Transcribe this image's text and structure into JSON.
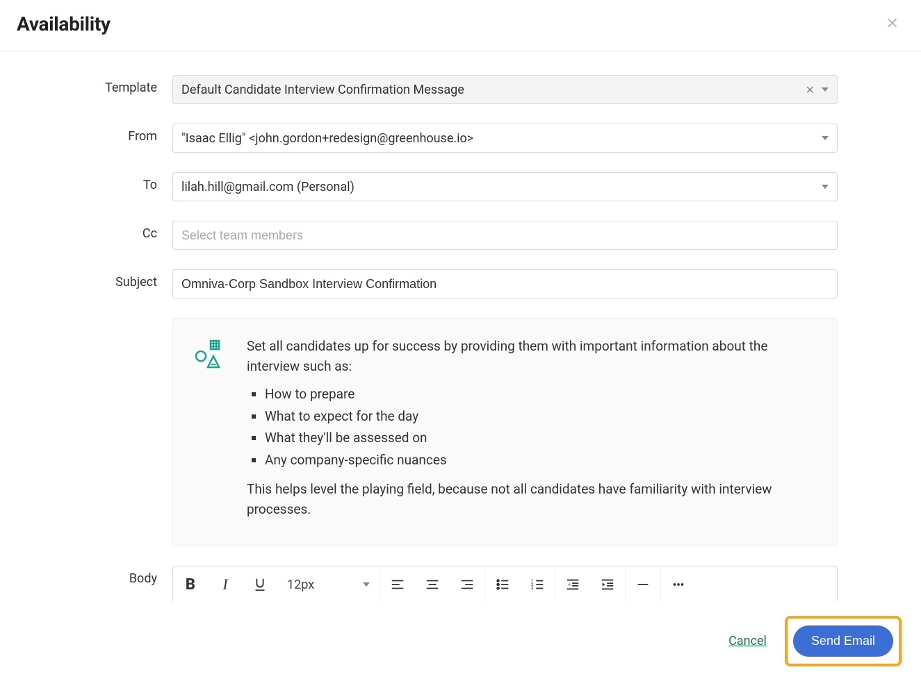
{
  "header": {
    "title": "Availability"
  },
  "labels": {
    "template": "Template",
    "from": "From",
    "to": "To",
    "cc": "Cc",
    "subject": "Subject",
    "body": "Body"
  },
  "fields": {
    "template_value": "Default Candidate Interview Confirmation Message",
    "from_value": "\"Isaac Ellig\" <john.gordon+redesign@greenhouse.io>",
    "to_value": "lilah.hill@gmail.com (Personal)",
    "cc_placeholder": "Select team members",
    "subject_value": "Omniva-Corp Sandbox Interview Confirmation"
  },
  "tip": {
    "intro": "Set all candidates up for success by providing them with important information about the interview such as:",
    "bullets": [
      "How to prepare",
      "What to expect for the day",
      "What they'll be assessed on",
      "Any company-specific nuances"
    ],
    "outro": "This helps level the playing field, because not all candidates have familiarity with interview processes."
  },
  "toolbar": {
    "font_size": "12px"
  },
  "footer": {
    "cancel": "Cancel",
    "send": "Send Email"
  }
}
